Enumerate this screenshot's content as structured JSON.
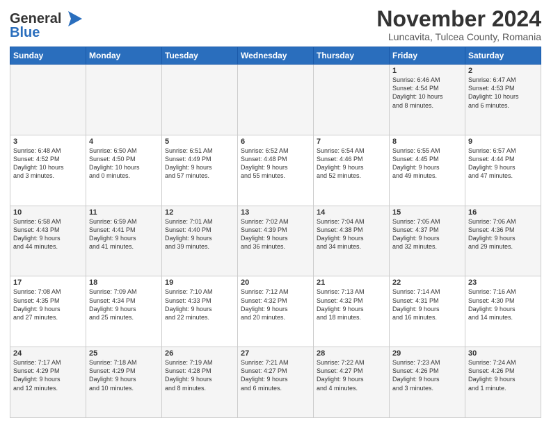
{
  "logo": {
    "line1": "General",
    "line2": "Blue"
  },
  "title": "November 2024",
  "subtitle": "Luncavita, Tulcea County, Romania",
  "weekdays": [
    "Sunday",
    "Monday",
    "Tuesday",
    "Wednesday",
    "Thursday",
    "Friday",
    "Saturday"
  ],
  "rows": [
    [
      {
        "day": "",
        "info": ""
      },
      {
        "day": "",
        "info": ""
      },
      {
        "day": "",
        "info": ""
      },
      {
        "day": "",
        "info": ""
      },
      {
        "day": "",
        "info": ""
      },
      {
        "day": "1",
        "info": "Sunrise: 6:46 AM\nSunset: 4:54 PM\nDaylight: 10 hours\nand 8 minutes."
      },
      {
        "day": "2",
        "info": "Sunrise: 6:47 AM\nSunset: 4:53 PM\nDaylight: 10 hours\nand 6 minutes."
      }
    ],
    [
      {
        "day": "3",
        "info": "Sunrise: 6:48 AM\nSunset: 4:52 PM\nDaylight: 10 hours\nand 3 minutes."
      },
      {
        "day": "4",
        "info": "Sunrise: 6:50 AM\nSunset: 4:50 PM\nDaylight: 10 hours\nand 0 minutes."
      },
      {
        "day": "5",
        "info": "Sunrise: 6:51 AM\nSunset: 4:49 PM\nDaylight: 9 hours\nand 57 minutes."
      },
      {
        "day": "6",
        "info": "Sunrise: 6:52 AM\nSunset: 4:48 PM\nDaylight: 9 hours\nand 55 minutes."
      },
      {
        "day": "7",
        "info": "Sunrise: 6:54 AM\nSunset: 4:46 PM\nDaylight: 9 hours\nand 52 minutes."
      },
      {
        "day": "8",
        "info": "Sunrise: 6:55 AM\nSunset: 4:45 PM\nDaylight: 9 hours\nand 49 minutes."
      },
      {
        "day": "9",
        "info": "Sunrise: 6:57 AM\nSunset: 4:44 PM\nDaylight: 9 hours\nand 47 minutes."
      }
    ],
    [
      {
        "day": "10",
        "info": "Sunrise: 6:58 AM\nSunset: 4:43 PM\nDaylight: 9 hours\nand 44 minutes."
      },
      {
        "day": "11",
        "info": "Sunrise: 6:59 AM\nSunset: 4:41 PM\nDaylight: 9 hours\nand 41 minutes."
      },
      {
        "day": "12",
        "info": "Sunrise: 7:01 AM\nSunset: 4:40 PM\nDaylight: 9 hours\nand 39 minutes."
      },
      {
        "day": "13",
        "info": "Sunrise: 7:02 AM\nSunset: 4:39 PM\nDaylight: 9 hours\nand 36 minutes."
      },
      {
        "day": "14",
        "info": "Sunrise: 7:04 AM\nSunset: 4:38 PM\nDaylight: 9 hours\nand 34 minutes."
      },
      {
        "day": "15",
        "info": "Sunrise: 7:05 AM\nSunset: 4:37 PM\nDaylight: 9 hours\nand 32 minutes."
      },
      {
        "day": "16",
        "info": "Sunrise: 7:06 AM\nSunset: 4:36 PM\nDaylight: 9 hours\nand 29 minutes."
      }
    ],
    [
      {
        "day": "17",
        "info": "Sunrise: 7:08 AM\nSunset: 4:35 PM\nDaylight: 9 hours\nand 27 minutes."
      },
      {
        "day": "18",
        "info": "Sunrise: 7:09 AM\nSunset: 4:34 PM\nDaylight: 9 hours\nand 25 minutes."
      },
      {
        "day": "19",
        "info": "Sunrise: 7:10 AM\nSunset: 4:33 PM\nDaylight: 9 hours\nand 22 minutes."
      },
      {
        "day": "20",
        "info": "Sunrise: 7:12 AM\nSunset: 4:32 PM\nDaylight: 9 hours\nand 20 minutes."
      },
      {
        "day": "21",
        "info": "Sunrise: 7:13 AM\nSunset: 4:32 PM\nDaylight: 9 hours\nand 18 minutes."
      },
      {
        "day": "22",
        "info": "Sunrise: 7:14 AM\nSunset: 4:31 PM\nDaylight: 9 hours\nand 16 minutes."
      },
      {
        "day": "23",
        "info": "Sunrise: 7:16 AM\nSunset: 4:30 PM\nDaylight: 9 hours\nand 14 minutes."
      }
    ],
    [
      {
        "day": "24",
        "info": "Sunrise: 7:17 AM\nSunset: 4:29 PM\nDaylight: 9 hours\nand 12 minutes."
      },
      {
        "day": "25",
        "info": "Sunrise: 7:18 AM\nSunset: 4:29 PM\nDaylight: 9 hours\nand 10 minutes."
      },
      {
        "day": "26",
        "info": "Sunrise: 7:19 AM\nSunset: 4:28 PM\nDaylight: 9 hours\nand 8 minutes."
      },
      {
        "day": "27",
        "info": "Sunrise: 7:21 AM\nSunset: 4:27 PM\nDaylight: 9 hours\nand 6 minutes."
      },
      {
        "day": "28",
        "info": "Sunrise: 7:22 AM\nSunset: 4:27 PM\nDaylight: 9 hours\nand 4 minutes."
      },
      {
        "day": "29",
        "info": "Sunrise: 7:23 AM\nSunset: 4:26 PM\nDaylight: 9 hours\nand 3 minutes."
      },
      {
        "day": "30",
        "info": "Sunrise: 7:24 AM\nSunset: 4:26 PM\nDaylight: 9 hours\nand 1 minute."
      }
    ]
  ]
}
